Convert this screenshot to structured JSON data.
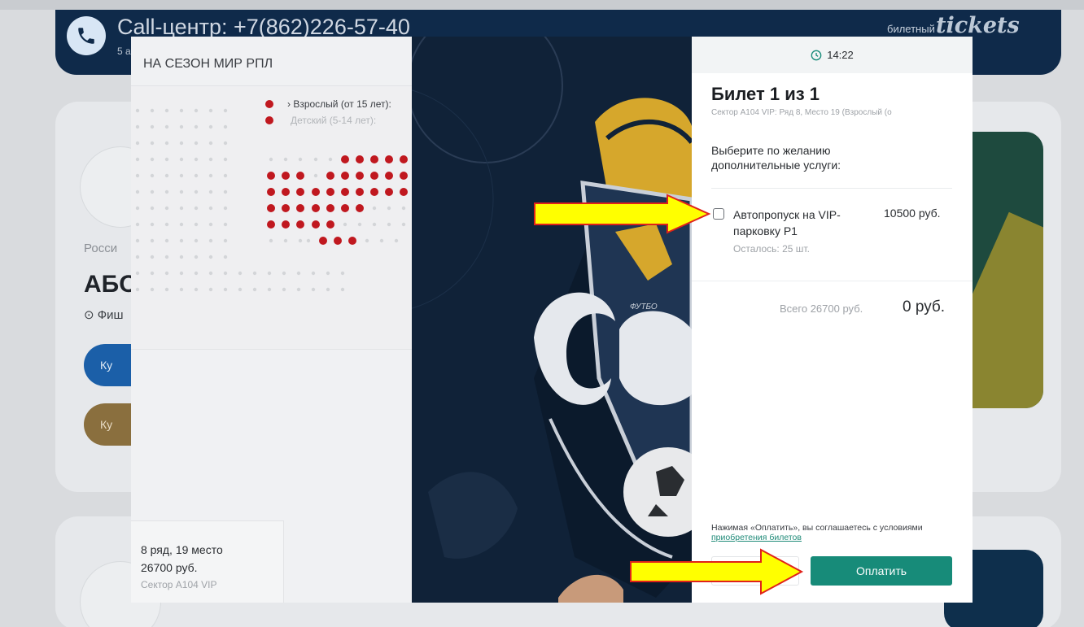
{
  "background": {
    "callcenter": "Call-центр: +7(862)226-57-40",
    "callcenter_sub": "5 а",
    "bilet_label": "билетный",
    "tickets_logo": "tickets",
    "country_partial": "Росси",
    "title_partial": "АБО",
    "location_partial": "⊙ Фиш",
    "buy_partial": "Ку",
    "buy_partial2": "Ку"
  },
  "left_pane": {
    "title": "НА СЕЗОН МИР РПЛ",
    "legend_adult": "› Взрослый (от 15 лет):",
    "legend_child": "Детский (5-14 лет):",
    "summary_row": "8 ряд, 19 место",
    "summary_price": "26700 руб.",
    "summary_sector": "Сектор А104 VIP"
  },
  "center": {
    "club_text": "ФУТБО"
  },
  "right_pane": {
    "timer": "14:22",
    "ticket_title": "Билет 1 из 1",
    "ticket_sub": "Сектор А104 VIP: Ряд 8, Место 19 (Взрослый (о",
    "choose_text": "Выберите по желанию дополнительные услуги:",
    "service_name": "Автопропуск на VIP-парковку Р1",
    "service_price": "10500 руб.",
    "service_left": "Осталось: 25 шт.",
    "total_label": "Всего 26700 руб.",
    "total_value": "0 руб.",
    "agree_text": "Нажимая «Оплатить», вы соглашаетесь с условиями ",
    "agree_link": "приобретения билетов",
    "pay_label": "Оплатить"
  },
  "colors": {
    "pay_button": "#178b79",
    "seat_selected": "#c0181f",
    "arrow": "#ffff00"
  }
}
